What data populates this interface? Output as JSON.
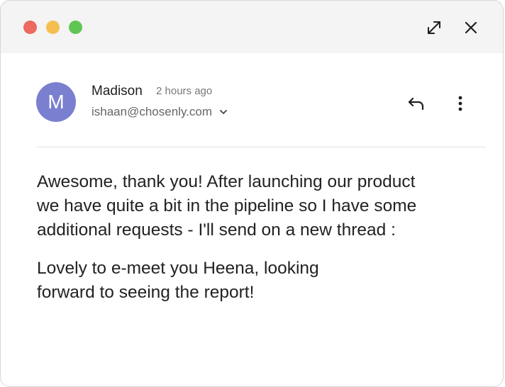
{
  "window": {
    "traffic_lights": {
      "close_color": "#ec6a5e",
      "minimize_color": "#f4bf4f",
      "maximize_color": "#61c554"
    },
    "expand_icon": "expand-icon",
    "close_icon": "close-icon"
  },
  "email": {
    "avatar_initial": "M",
    "avatar_color": "#7b7fcf",
    "sender_name": "Madison",
    "timestamp": "2 hours ago",
    "sender_email": "ishaan@chosenly.com",
    "reply_icon": "reply-icon",
    "more_icon": "more-vertical-icon",
    "body_lines_1": [
      "Awesome, thank you! After launching our product",
      "we have quite a bit in the pipeline so I have some",
      "additional requests - I'll send on a new thread :"
    ],
    "body_lines_2": [
      "Lovely to e-meet you Heena, looking",
      "forward to seeing the report!"
    ]
  }
}
